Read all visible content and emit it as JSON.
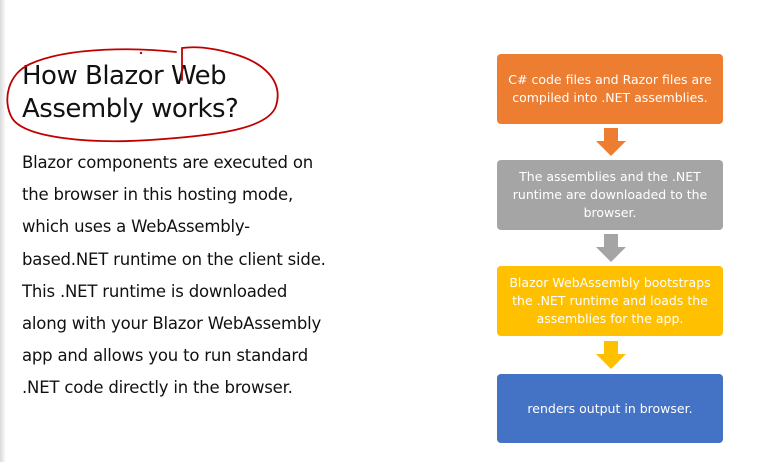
{
  "slide": {
    "title_lines": [
      "How Blazor Web",
      "Assembly works?"
    ],
    "body_lines": [
      "Blazor components are executed on",
      "the browser in this hosting mode,",
      "which uses a WebAssembly-",
      "based.NET runtime on the client side.",
      "This .NET runtime is downloaded",
      "along with your Blazor WebAssembly",
      "app and allows you to run standard",
      ".NET code directly in the browser."
    ]
  },
  "flow": {
    "steps": [
      {
        "text": "C# code files and Razor files are compiled into .NET assemblies.",
        "color": "#ed7d31"
      },
      {
        "text": "The assemblies and the .NET runtime are downloaded to the browser.",
        "color": "#a5a5a5"
      },
      {
        "text": "Blazor WebAssembly bootstraps the .NET runtime and loads the assemblies for the app.",
        "color": "#ffc000"
      },
      {
        "text": "renders output in browser.",
        "color": "#4472c4"
      }
    ],
    "arrow_colors": [
      "#ed7d31",
      "#a5a5a5",
      "#ffc000"
    ]
  },
  "annotation": {
    "color": "#c00000"
  }
}
